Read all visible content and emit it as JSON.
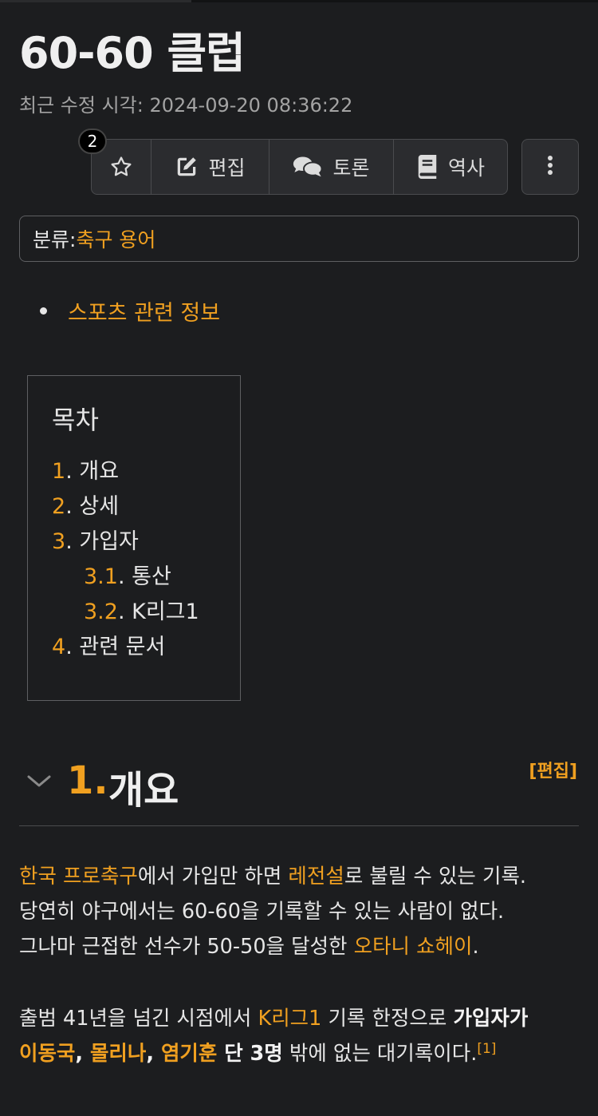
{
  "page": {
    "title": "60-60 클럽",
    "modified": "최근 수정 시각: 2024-09-20 08:36:22"
  },
  "toolbar": {
    "badge_count": "2",
    "star_icon": "star-icon",
    "edit_label": "편집",
    "discuss_label": "토론",
    "history_label": "역사",
    "more_icon": "more-vertical-icon"
  },
  "category": {
    "label": "분류:",
    "value": "축구 용어"
  },
  "related": {
    "item": "스포츠 관련 정보"
  },
  "toc": {
    "title": "목차",
    "items": [
      {
        "num": "1",
        "text": ". 개요"
      },
      {
        "num": "2",
        "text": ". 상세"
      },
      {
        "num": "3",
        "text": ". 가입자"
      },
      {
        "num": "3.1",
        "text": ". 통산"
      },
      {
        "num": "3.2",
        "text": ". K리그1"
      },
      {
        "num": "4",
        "text": ". 관련 문서"
      }
    ]
  },
  "section1": {
    "num": "1.",
    "title": "개요",
    "edit": "[편집]"
  },
  "para1": {
    "l1_link1": "한국 프로축구",
    "l1_t1": "에서 가입만 하면 ",
    "l1_link2": "레전설",
    "l1_t2": "로 불릴 수 있는 기록.",
    "l2": "당연히 야구에서는 60-60을 기록할 수 있는 사람이 없다.",
    "l3_t1": "그나마 근접한 선수가 50-50을 달성한 ",
    "l3_link": "오타니 쇼헤이",
    "l3_t2": "."
  },
  "para2": {
    "t1": "출범 41년을 넘긴 시점에서 ",
    "link1": "K리그1",
    "t2": " 기록 한정으로 ",
    "bold1": "가입자가",
    "link2": "이동국",
    "sep1": ", ",
    "link3": "몰리나",
    "sep2": ", ",
    "link4": "염기훈",
    "bold2": " 단 3명",
    "t3": " 밖에 없는 대기록이다.",
    "footnote": "[1]"
  },
  "colors": {
    "background": "#1c1d1f",
    "link": "#f0a020",
    "text": "#e6e6e6",
    "border": "#4a4b4e"
  }
}
